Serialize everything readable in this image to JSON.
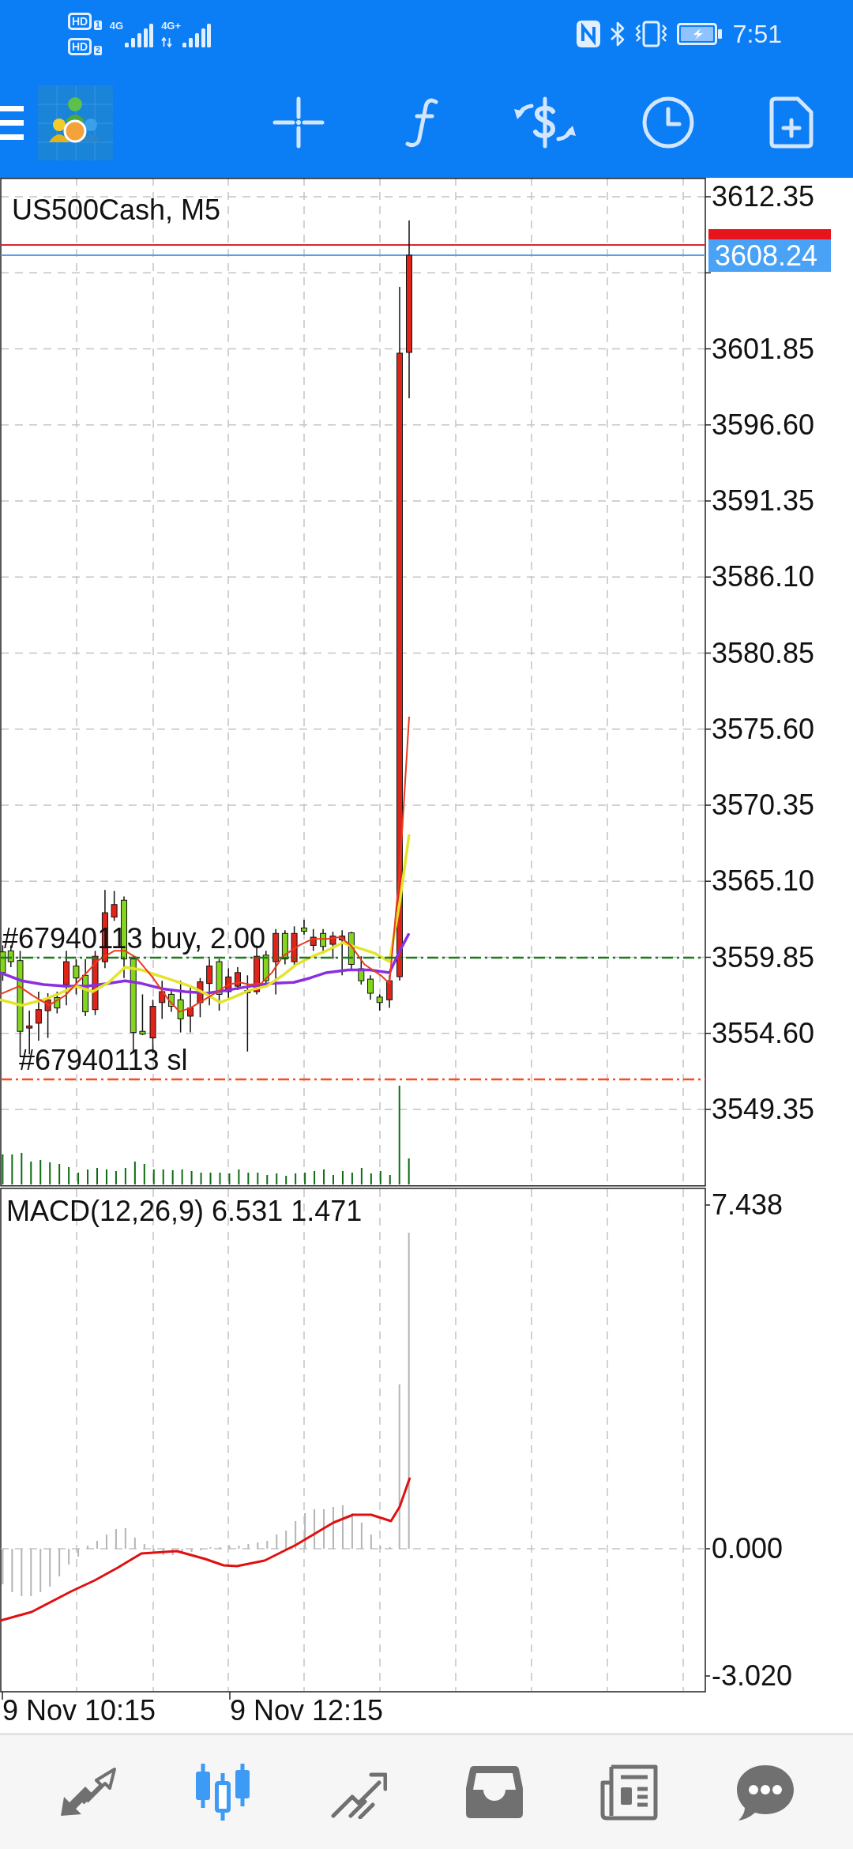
{
  "status_bar": {
    "sim_badges": [
      {
        "label": "HD",
        "slot": "1"
      },
      {
        "label": "HD",
        "slot": "2"
      }
    ],
    "networks": [
      {
        "label": "4G",
        "activity": false
      },
      {
        "label": "4G+",
        "activity": true
      }
    ],
    "time": "7:51"
  },
  "chart": {
    "symbol": "US500Cash, M5",
    "price_axis": [
      "3612.35",
      "3601.85",
      "3596.60",
      "3591.35",
      "3586.10",
      "3580.85",
      "3575.60",
      "3570.35",
      "3565.10",
      "3559.85",
      "3554.60",
      "3549.35"
    ],
    "bid_label": "3608.24",
    "order_lines": [
      {
        "kind": "entry",
        "label": "#67940113 buy, 2.00",
        "color": "#1f7a1f"
      },
      {
        "kind": "stop_loss",
        "label": "#67940113 sl",
        "color": "#ff4a1c"
      }
    ]
  },
  "macd": {
    "label": "MACD(12,26,9) 6.531 1.471",
    "axis": [
      "7.438",
      "0.000",
      "-3.020"
    ]
  },
  "time_axis": [
    "9 Nov 10:15",
    "9 Nov 12:15"
  ],
  "bottom_nav": [
    {
      "kind": "quotes",
      "selected": false
    },
    {
      "kind": "chart",
      "selected": true
    },
    {
      "kind": "trade",
      "selected": false
    },
    {
      "kind": "history",
      "selected": false
    },
    {
      "kind": "news",
      "selected": false
    },
    {
      "kind": "chat",
      "selected": false
    }
  ]
}
